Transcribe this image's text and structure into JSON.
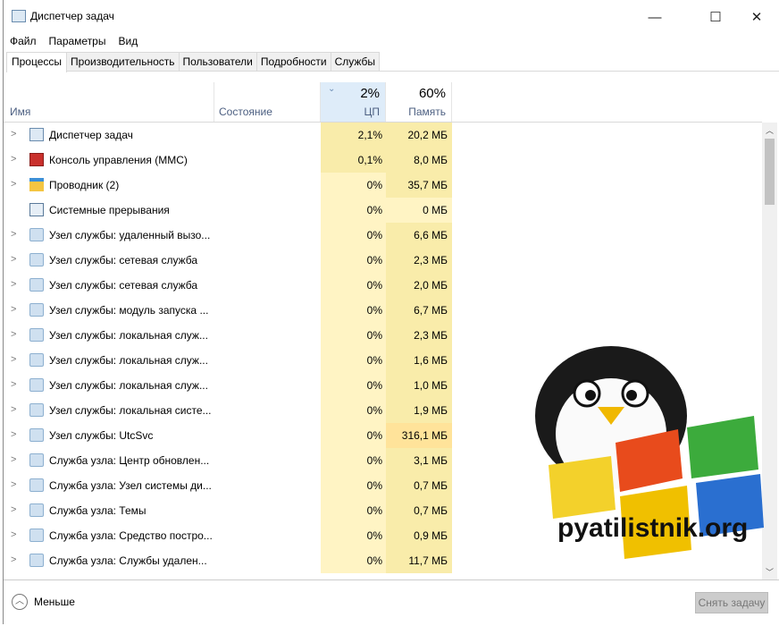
{
  "window": {
    "title": "Диспетчер задач",
    "minimize": "—",
    "maximize": "☐",
    "close": "✕"
  },
  "menu": [
    "Файл",
    "Параметры",
    "Вид"
  ],
  "tabs": [
    "Процессы",
    "Производительность",
    "Пользователи",
    "Подробности",
    "Службы"
  ],
  "columns": {
    "name": "Имя",
    "state": "Состояние",
    "cpu": "ЦП",
    "cpu_total": "2%",
    "memory": "Память",
    "memory_total": "60%"
  },
  "rows": [
    {
      "name": "Диспетчер задач",
      "cpu": "2,1%",
      "mem": "20,2 МБ",
      "expand": true,
      "icon": "taskmgr",
      "cpu_level": 2,
      "mem_level": 2
    },
    {
      "name": "Консоль управления (MMC)",
      "cpu": "0,1%",
      "mem": "8,0 МБ",
      "expand": true,
      "icon": "mmc",
      "cpu_level": 2,
      "mem_level": 2
    },
    {
      "name": "Проводник (2)",
      "cpu": "0%",
      "mem": "35,7 МБ",
      "expand": true,
      "icon": "folder",
      "cpu_level": 1,
      "mem_level": 2
    },
    {
      "name": "Системные прерывания",
      "cpu": "0%",
      "mem": "0 МБ",
      "expand": false,
      "icon": "system",
      "cpu_level": 1,
      "mem_level": 1
    },
    {
      "name": "Узел службы: удаленный вызо...",
      "cpu": "0%",
      "mem": "6,6 МБ",
      "expand": true,
      "icon": "gear",
      "cpu_level": 1,
      "mem_level": 2
    },
    {
      "name": "Узел службы: сетевая служба",
      "cpu": "0%",
      "mem": "2,3 МБ",
      "expand": true,
      "icon": "gear",
      "cpu_level": 1,
      "mem_level": 2
    },
    {
      "name": "Узел службы: сетевая служба",
      "cpu": "0%",
      "mem": "2,0 МБ",
      "expand": true,
      "icon": "gear",
      "cpu_level": 1,
      "mem_level": 2
    },
    {
      "name": "Узел службы: модуль запуска ...",
      "cpu": "0%",
      "mem": "6,7 МБ",
      "expand": true,
      "icon": "gear",
      "cpu_level": 1,
      "mem_level": 2
    },
    {
      "name": "Узел службы: локальная служ...",
      "cpu": "0%",
      "mem": "2,3 МБ",
      "expand": true,
      "icon": "gear",
      "cpu_level": 1,
      "mem_level": 2
    },
    {
      "name": "Узел службы: локальная служ...",
      "cpu": "0%",
      "mem": "1,6 МБ",
      "expand": true,
      "icon": "gear",
      "cpu_level": 1,
      "mem_level": 2
    },
    {
      "name": "Узел службы: локальная служ...",
      "cpu": "0%",
      "mem": "1,0 МБ",
      "expand": true,
      "icon": "gear",
      "cpu_level": 1,
      "mem_level": 2
    },
    {
      "name": "Узел службы: локальная систе...",
      "cpu": "0%",
      "mem": "1,9 МБ",
      "expand": true,
      "icon": "gear",
      "cpu_level": 1,
      "mem_level": 2
    },
    {
      "name": "Узел службы: UtcSvc",
      "cpu": "0%",
      "mem": "316,1 МБ",
      "expand": true,
      "icon": "gear",
      "cpu_level": 1,
      "mem_level": 3
    },
    {
      "name": "Служба узла: Центр обновлен...",
      "cpu": "0%",
      "mem": "3,1 МБ",
      "expand": true,
      "icon": "gear",
      "cpu_level": 1,
      "mem_level": 2
    },
    {
      "name": "Служба узла: Узел системы ди...",
      "cpu": "0%",
      "mem": "0,7 МБ",
      "expand": true,
      "icon": "gear",
      "cpu_level": 1,
      "mem_level": 2
    },
    {
      "name": "Служба узла: Темы",
      "cpu": "0%",
      "mem": "0,7 МБ",
      "expand": true,
      "icon": "gear",
      "cpu_level": 1,
      "mem_level": 2
    },
    {
      "name": "Служба узла: Средство постро...",
      "cpu": "0%",
      "mem": "0,9 МБ",
      "expand": true,
      "icon": "gear",
      "cpu_level": 1,
      "mem_level": 2
    },
    {
      "name": "Служба узла: Службы удален...",
      "cpu": "0%",
      "mem": "11,7 МБ",
      "expand": true,
      "icon": "gear",
      "cpu_level": 1,
      "mem_level": 2
    }
  ],
  "footer": {
    "less": "Меньше",
    "end_task": "Снять задачу"
  },
  "watermark": "pyatilistnik.org",
  "colors": {
    "heat1": "#fff4c4",
    "heat2": "#f9ecaa",
    "heat3": "#ffe39a",
    "header_sort": "#deecf9"
  }
}
